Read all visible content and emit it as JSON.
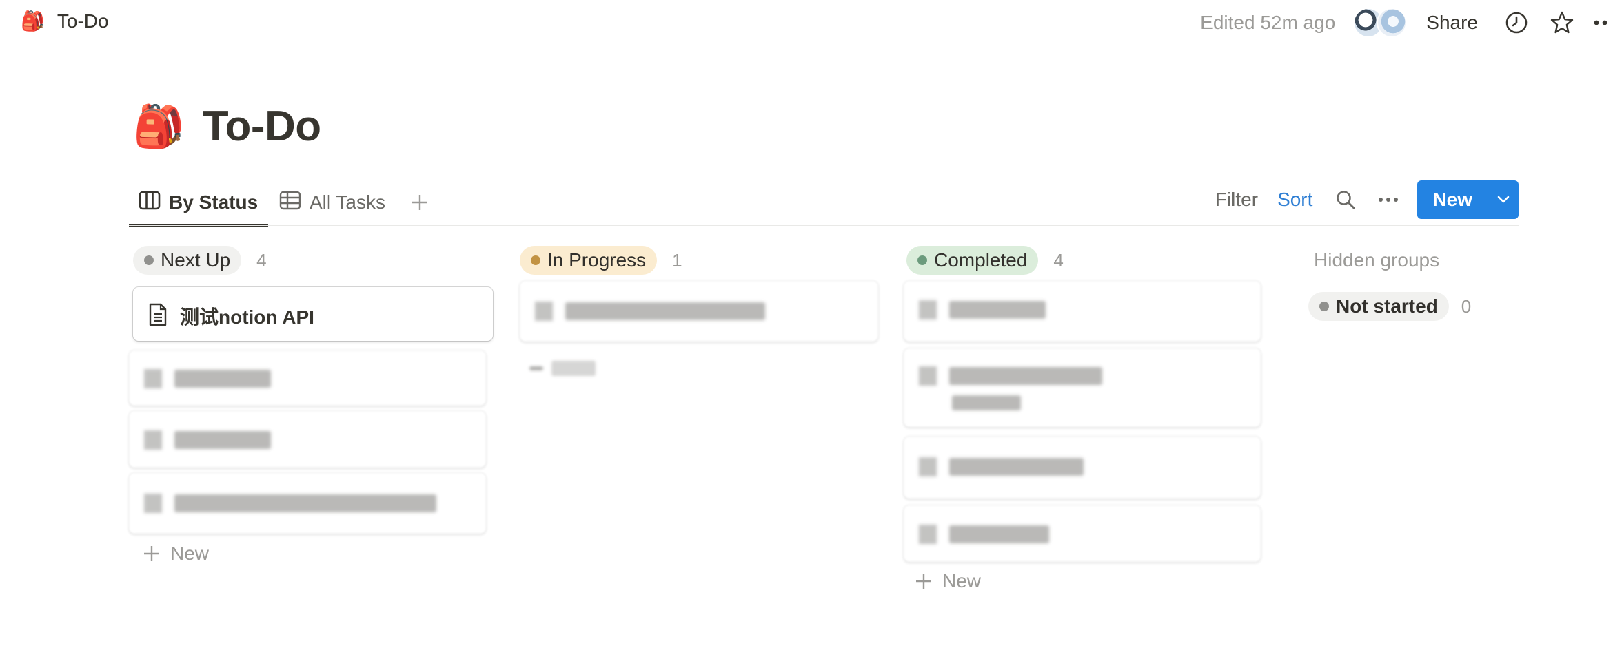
{
  "topbar": {
    "breadcrumb_emoji": "🎒",
    "breadcrumb_title": "To-Do",
    "edited": "Edited 52m ago",
    "share": "Share"
  },
  "page": {
    "emoji": "🎒",
    "title": "To-Do"
  },
  "views": {
    "tabs": [
      {
        "label": "By Status",
        "icon": "board-icon",
        "active": true
      },
      {
        "label": "All Tasks",
        "icon": "table-icon",
        "active": false
      }
    ],
    "filter": "Filter",
    "sort": "Sort",
    "new_button": "New"
  },
  "board": {
    "columns": [
      {
        "name": "Next Up",
        "count": "4",
        "dot_color": "#91918e",
        "bg": "#f1f1ef",
        "cards": [
          {
            "title": "测试notion API",
            "icon": "page-icon"
          }
        ],
        "new_label": "New"
      },
      {
        "name": "In Progress",
        "count": "1",
        "dot_color": "#c29343",
        "bg": "#fbecd0",
        "cards": [],
        "new_label": ""
      },
      {
        "name": "Completed",
        "count": "4",
        "dot_color": "#6c9b7d",
        "bg": "#dbeddb",
        "cards": [],
        "new_label": "New"
      }
    ],
    "hidden": {
      "title": "Hidden groups",
      "groups": [
        {
          "name": "Not started",
          "count": "0",
          "dot_color": "#91918e",
          "bg": "#f1f1ef"
        }
      ]
    }
  },
  "colors": {
    "accent": "#2383e2",
    "sort_text": "#2f7fd4",
    "text": "#37352f",
    "muted": "#9b9a97"
  }
}
